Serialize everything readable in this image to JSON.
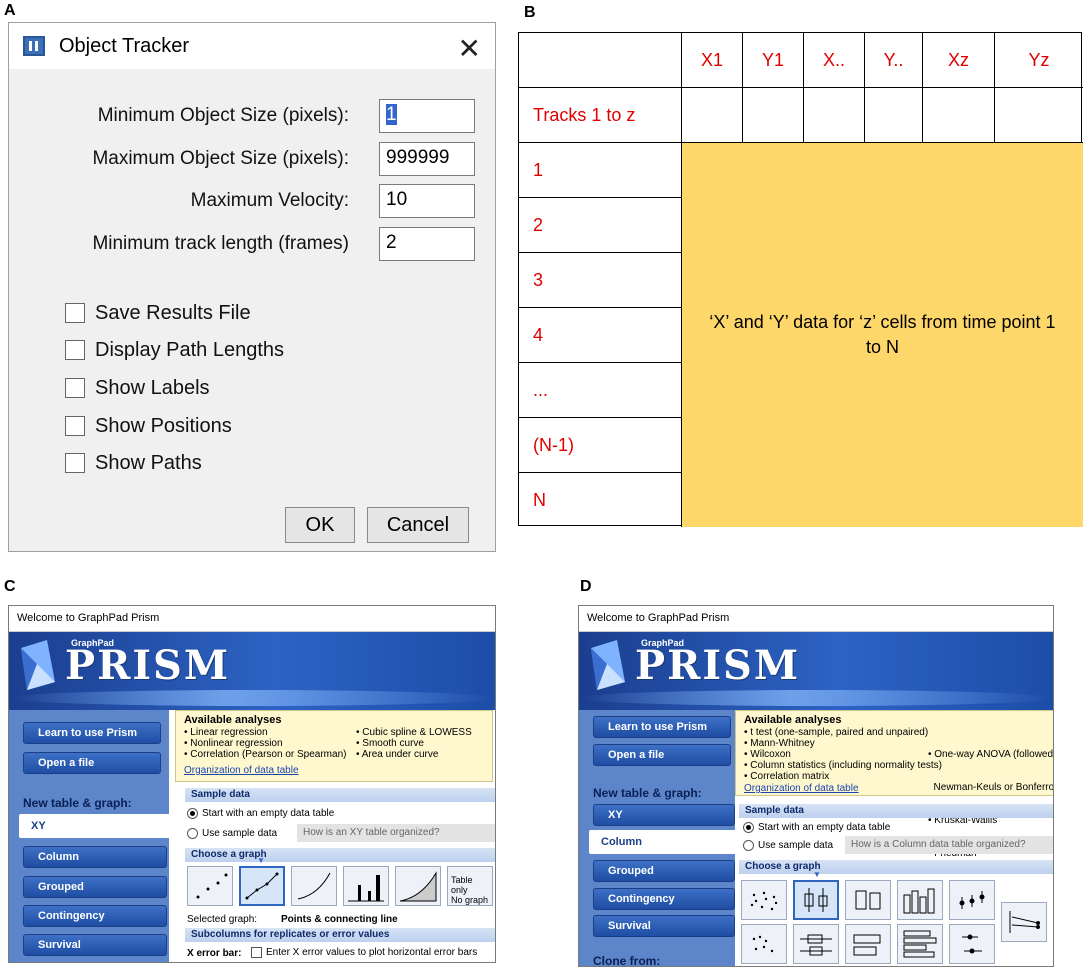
{
  "panels": {
    "a": "A",
    "b": "B",
    "c": "C",
    "d": "D"
  },
  "tracker": {
    "title": "Object Tracker",
    "fields": [
      {
        "label": "Minimum Object Size (pixels):",
        "value": "1"
      },
      {
        "label": "Maximum Object Size (pixels):",
        "value": "999999"
      },
      {
        "label": "Maximum  Velocity:",
        "value": "10"
      },
      {
        "label": "Minimum  track length (frames)",
        "value": "2"
      }
    ],
    "checkboxes": [
      "Save Results File",
      "Display Path Lengths",
      "Show Labels",
      "Show Positions",
      "Show Paths"
    ],
    "ok": "OK",
    "cancel": "Cancel"
  },
  "table": {
    "headers": [
      "X1",
      "Y1",
      "X..",
      "Y..",
      "Xz",
      "Yz"
    ],
    "tracks_label": "Tracks 1 to z",
    "rows": [
      "1",
      "2",
      "3",
      "4",
      "...",
      "(N-1)",
      "N"
    ],
    "body_text": "‘X’ and ‘Y’ data for ‘z’ cells from time point 1 to N"
  },
  "prism_c": {
    "window_title": "Welcome to GraphPad Prism",
    "brand_small": "GraphPad",
    "brand": "PRISM",
    "nav": {
      "learn": "Learn to use Prism",
      "open": "Open a file",
      "new_header": "New table & graph:",
      "items": [
        "XY",
        "Column",
        "Grouped",
        "Contingency",
        "Survival"
      ]
    },
    "analyses": {
      "title": "Available analyses",
      "col1": [
        "• Linear regression",
        "• Nonlinear regression",
        "• Correlation (Pearson or Spearman)"
      ],
      "col2": [
        "• Cubic spline & LOWESS",
        "• Smooth curve",
        "• Area under curve"
      ],
      "link": "Organization of data table"
    },
    "sample_header": "Sample data",
    "radio_empty": "Start with an empty data table",
    "radio_sample": "Use sample data",
    "sample_placeholder": "How is an XY table organized?",
    "choose_header": "Choose a graph",
    "table_only": "Table only\nNo graph",
    "selected_label": "Selected graph:",
    "selected_value": "Points & connecting line",
    "subcol_header": "Subcolumns for replicates or error values",
    "xerror_label": "X error bar:",
    "xerror_text": "Enter X error values to plot horizontal error bars"
  },
  "prism_d": {
    "window_title": "Welcome to GraphPad Prism",
    "brand_small": "GraphPad",
    "brand": "PRISM",
    "nav": {
      "learn": "Learn to use Prism",
      "open": "Open a file",
      "new_header": "New table & graph:",
      "items": [
        "XY",
        "Column",
        "Grouped",
        "Contingency",
        "Survival"
      ],
      "clone": "Clone from:"
    },
    "analyses": {
      "title": "Available analyses",
      "col1": [
        "• t test (one-sample, paired and unpaired)",
        "• Mann-Whitney",
        "• Wilcoxon",
        "• Column statistics (including normality tests)",
        "• Correlation matrix"
      ],
      "col2": [
        "• One-way ANOVA (followed by",
        "  Newman-Keuls or Bonferroni p",
        "• Kruskal-Wallis",
        "• Friedman"
      ],
      "link": "Organization of data table"
    },
    "sample_header": "Sample data",
    "radio_empty": "Start with an empty data table",
    "radio_sample": "Use sample data",
    "sample_placeholder": "How is a Column data table organized?",
    "choose_header": "Choose a graph"
  }
}
